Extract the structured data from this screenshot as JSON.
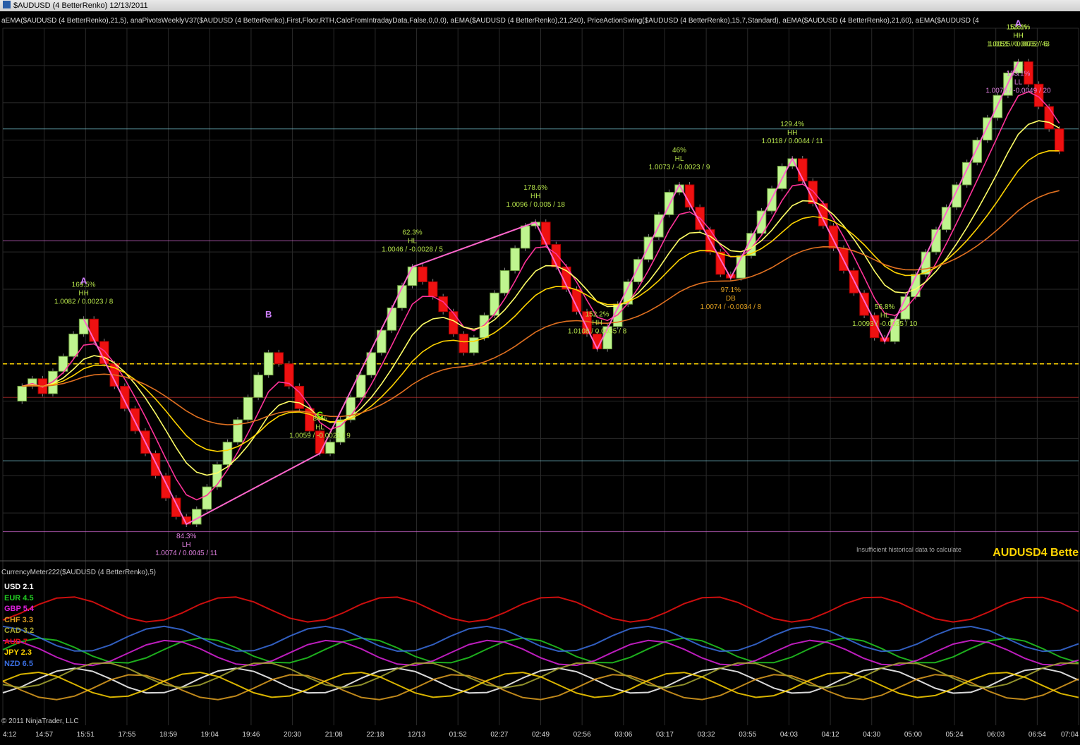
{
  "window": {
    "title": "$AUDUSD (4 BetterRenko)  12/13/2011"
  },
  "indicators_line": "aEMA($AUDUSD (4 BetterRenko),21,5), anaPivotsWeeklyV37($AUDUSD (4 BetterRenko),First,Floor,RTH,CalcFromIntradayData,False,0,0,0), aEMA($AUDUSD (4 BetterRenko),21,240), PriceActionSwing($AUDUSD (4 BetterRenko),15,7,Standard), aEMA($AUDUSD (4 BetterRenko),21,60), aEMA($AUDUSD (4",
  "meter_title": "CurrencyMeter222($AUDUSD (4 BetterRenko),5)",
  "copyright": "© 2011 NinjaTrader, LLC",
  "watermark": "AUDUSD4 Bette",
  "insufficient_text": "Insufficient historical data to calculate",
  "currency_meter": [
    {
      "code": "USD",
      "value": "2.1",
      "color": "#ffffff"
    },
    {
      "code": "EUR",
      "value": "4.5",
      "color": "#22cc22"
    },
    {
      "code": "GBP",
      "value": "5.4",
      "color": "#dd22dd"
    },
    {
      "code": "CHF",
      "value": "3.3",
      "color": "#e0a020"
    },
    {
      "code": "CAD",
      "value": "3.2",
      "color": "#aaaa33"
    },
    {
      "code": "AUD",
      "value": "7",
      "color": "#ee1111"
    },
    {
      "code": "JPY",
      "value": "2.3",
      "color": "#ffd400"
    },
    {
      "code": "NZD",
      "value": "6.5",
      "color": "#3a6ee0"
    }
  ],
  "chart_data": {
    "type": "candlestick",
    "symbol": "$AUDUSD",
    "bar_type": "4 BetterRenko",
    "date": "12/13/2011",
    "x_ticks": [
      "4:12",
      "14:57",
      "15:51",
      "17:55",
      "18:59",
      "19:04",
      "19:46",
      "20:30",
      "21:08",
      "22:18",
      "12/13",
      "01:52",
      "02:27",
      "02:49",
      "02:56",
      "03:06",
      "03:17",
      "03:32",
      "03:55",
      "04:03",
      "04:12",
      "04:30",
      "05:00",
      "05:24",
      "06:03",
      "06:54",
      "07:04"
    ],
    "swing_labels": [
      {
        "pct": "169.5%",
        "type": "HH",
        "text": "1.0082 / 0.0023 / 8",
        "color": "#b4e14a"
      },
      {
        "pct": "84.3%",
        "type": "LH",
        "text": "1.0074 / 0.0045 / 11",
        "color": "#e080e0"
      },
      {
        "pct": "84%",
        "type": "HL",
        "text": "1.0059 / -0.0021 / 9",
        "color": "#b4e14a"
      },
      {
        "pct": "62.3%",
        "type": "HL",
        "text": "1.0046 / -0.0028 / 5",
        "color": "#b4e14a"
      },
      {
        "pct": "178.6%",
        "type": "HH",
        "text": "1.0096 / 0.005 / 18",
        "color": "#b4e14a"
      },
      {
        "pct": "152.2%",
        "type": "HH",
        "text": "1.0108 / 0.0035 / 8",
        "color": "#b4e14a"
      },
      {
        "pct": "46%",
        "type": "HL",
        "text": "1.0073 / -0.0023 / 9",
        "color": "#b4e14a"
      },
      {
        "pct": "97.1%",
        "type": "DB",
        "text": "1.0074 / -0.0034 / 8",
        "color": "#e0a020"
      },
      {
        "pct": "129.4%",
        "type": "HH",
        "text": "1.0118 / 0.0044 / 11",
        "color": "#b4e14a"
      },
      {
        "pct": "56.8%",
        "type": "HL",
        "text": "1.0093 / -0.0025 / 10",
        "color": "#b4e14a"
      },
      {
        "pct": "128%",
        "type": "HH",
        "text": "1.0125 / 0.0032 / 6",
        "color": "#b4e14a"
      },
      {
        "pct": "153.1%",
        "type": "LL",
        "text": "1.0076 / -0.0049 / 20",
        "color": "#e080e0"
      },
      {
        "pct": "153.1%",
        "type": "HH",
        "text": "1.0151 / 0.0075 / 43",
        "color": "#b4e14a"
      }
    ],
    "pattern_letters": [
      "A",
      "B",
      "C",
      "A"
    ],
    "closes": [
      1.0064,
      1.0066,
      1.0062,
      1.0068,
      1.0072,
      1.0078,
      1.0082,
      1.0076,
      1.007,
      1.0064,
      1.0058,
      1.0052,
      1.0046,
      1.004,
      1.0034,
      1.0029,
      1.0027,
      1.0031,
      1.0037,
      1.0043,
      1.0049,
      1.0055,
      1.0061,
      1.0067,
      1.0073,
      1.007,
      1.0064,
      1.0058,
      1.0052,
      1.0046,
      1.0049,
      1.0055,
      1.0061,
      1.0067,
      1.0073,
      1.0079,
      1.0085,
      1.0091,
      1.0096,
      1.0092,
      1.0088,
      1.0084,
      1.0078,
      1.0073,
      1.0077,
      1.0083,
      1.0089,
      1.0095,
      1.0101,
      1.0107,
      1.0108,
      1.0102,
      1.0096,
      1.009,
      1.0084,
      1.0078,
      1.0074,
      1.008,
      1.0086,
      1.0092,
      1.0098,
      1.0104,
      1.011,
      1.0116,
      1.0118,
      1.0112,
      1.0106,
      1.01,
      1.0094,
      1.0093,
      1.0099,
      1.0105,
      1.0111,
      1.0117,
      1.0123,
      1.0125,
      1.0119,
      1.0113,
      1.0107,
      1.0101,
      1.0095,
      1.0089,
      1.0083,
      1.0077,
      1.0076,
      1.0082,
      1.0088,
      1.0094,
      1.01,
      1.0106,
      1.0112,
      1.0118,
      1.0124,
      1.013,
      1.0136,
      1.0142,
      1.0148,
      1.0151,
      1.0145,
      1.0139,
      1.0133,
      1.0127
    ]
  }
}
